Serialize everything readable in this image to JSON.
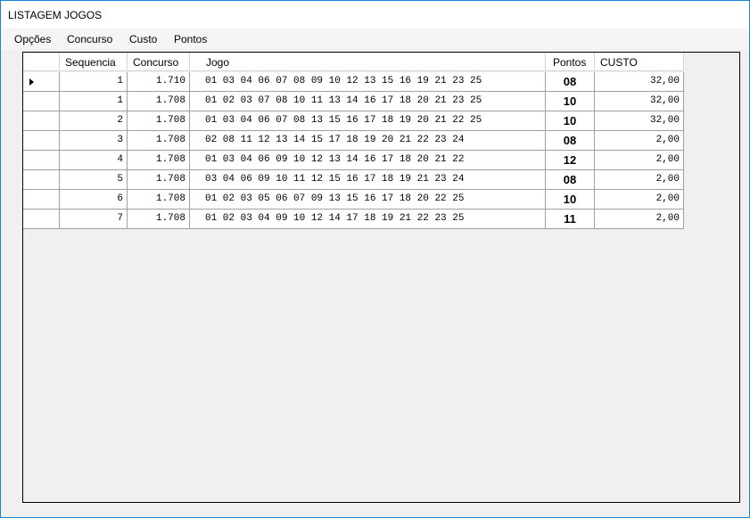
{
  "window": {
    "title": "LISTAGEM JOGOS"
  },
  "menu": [
    "Opções",
    "Concurso",
    "Custo",
    "Pontos"
  ],
  "grid": {
    "columns": [
      "Sequencia",
      "Concurso",
      "Jogo",
      "Pontos",
      "CUSTO"
    ],
    "selected_row": 0,
    "rows": [
      {
        "sequencia": "1",
        "concurso": "1.710",
        "jogo": "01 03 04 06 07 08 09 10 12 13 15 16 19 21 23 25",
        "pontos": "08",
        "custo": "32,00"
      },
      {
        "sequencia": "1",
        "concurso": "1.708",
        "jogo": "01 02 03 07 08 10 11 13 14 16 17 18 20 21 23 25",
        "pontos": "10",
        "custo": "32,00"
      },
      {
        "sequencia": "2",
        "concurso": "1.708",
        "jogo": "01 03 04 06 07 08 13 15 16 17 18 19 20 21 22 25",
        "pontos": "10",
        "custo": "32,00"
      },
      {
        "sequencia": "3",
        "concurso": "1.708",
        "jogo": "02 08 11 12 13 14 15 17 18 19 20 21 22 23 24",
        "pontos": "08",
        "custo": "2,00"
      },
      {
        "sequencia": "4",
        "concurso": "1.708",
        "jogo": "01 03 04 06 09 10 12 13 14 16 17 18 20 21 22",
        "pontos": "12",
        "custo": "2,00"
      },
      {
        "sequencia": "5",
        "concurso": "1.708",
        "jogo": "03 04 06 09 10 11 12 15 16 17 18 19 21 23 24",
        "pontos": "08",
        "custo": "2,00"
      },
      {
        "sequencia": "6",
        "concurso": "1.708",
        "jogo": "01 02 03 05 06 07 09 13 15 16 17 18 20 22 25",
        "pontos": "10",
        "custo": "2,00"
      },
      {
        "sequencia": "7",
        "concurso": "1.708",
        "jogo": "01 02 03 04 09 10 12 14 17 18 19 21 22 23 25",
        "pontos": "11",
        "custo": "2,00"
      }
    ]
  }
}
